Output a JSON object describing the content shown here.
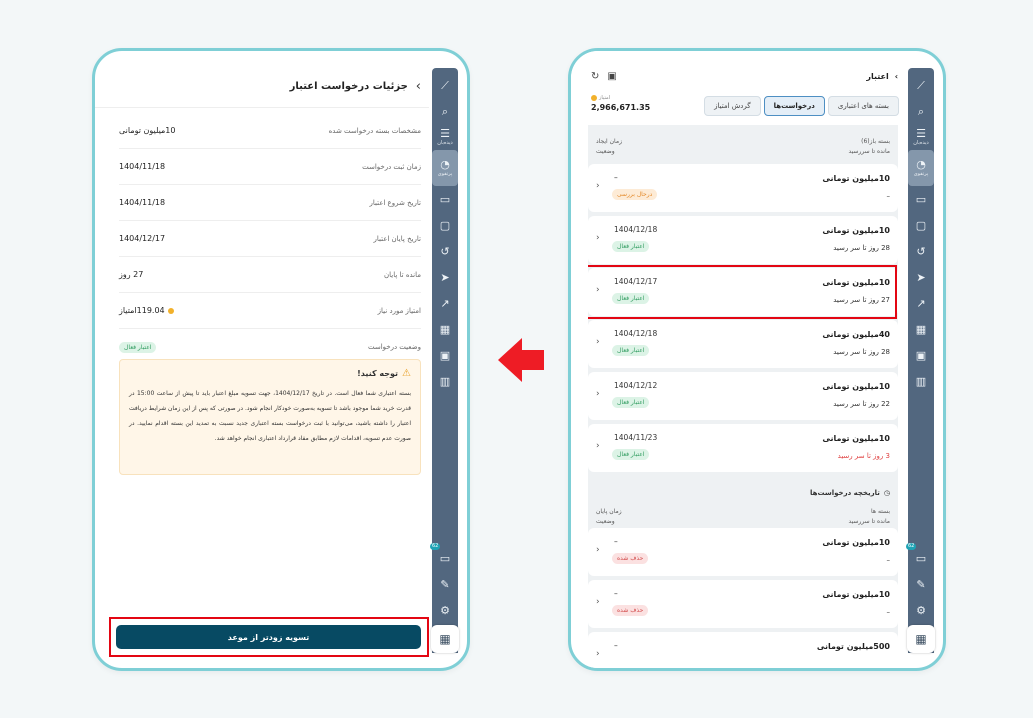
{
  "left": {
    "title": "جزئیات درخواست اعتبار",
    "rows": [
      {
        "label": "مشخصات بسته درخواست شده",
        "value": "10میلیون تومانی"
      },
      {
        "label": "زمان ثبت درخواست",
        "value": "1404/11/18"
      },
      {
        "label": "تاریخ شروع اعتبار",
        "value": "1404/11/18"
      },
      {
        "label": "تاریخ پایان اعتبار",
        "value": "1404/12/17"
      },
      {
        "label": "مانده تا پایان",
        "value": "27 روز"
      },
      {
        "label": "امتیاز مورد نیاز",
        "value": "119.04امتیاز"
      },
      {
        "label": "وضعیت درخواست",
        "value": "اعتبار فعال"
      }
    ],
    "notice_title": "توجه کنید!",
    "notice_body": "بسته اعتباری شما فعال است. در تاریخ 1404/12/17، جهت تسویه مبلغ اعتبار باید تا پیش از ساعت 15:00 در قدرت خرید شما موجود باشد تا تسویه به‌صورت خودکار انجام شود. در صورتی که پس از این زمان شرایط دریافت اعتبار را داشته باشید، می‌توانید با ثبت درخواست بسته اعتباری جدید نسبت به تمدید این بسته اقدام نمایید. در صورت عدم تسویه، اقدامات لازم مطابق مفاد قرارداد اعتباری انجام خواهد شد.",
    "cta": "تسویه زودتر از موعد"
  },
  "right": {
    "title": "اعتبار",
    "tabs": [
      "بسته های اعتباری",
      "درخواست‌ها",
      "گردش امتیاز"
    ],
    "balance_label": "امتیاز",
    "balance_value": "2,966,671.35",
    "open_header": {
      "right_top": "بسته باز(6)",
      "right_bottom": "مانده تا سررسید",
      "left_top": "زمان ایجاد",
      "left_bottom": "وضعیت"
    },
    "open_items": [
      {
        "name": "10میلیون تومانی",
        "remaining": "–",
        "date": "–",
        "status": "درحال بررسی",
        "status_type": "orange"
      },
      {
        "name": "10میلیون تومانی",
        "remaining": "28 روز تا سر رسید",
        "date": "1404/12/18",
        "status": "اعتبار فعال",
        "status_type": "green"
      },
      {
        "name": "10میلیون تومانی",
        "remaining": "27 روز تا سر رسید",
        "date": "1404/12/17",
        "status": "اعتبار فعال",
        "status_type": "green"
      },
      {
        "name": "40میلیون تومانی",
        "remaining": "28 روز تا سر رسید",
        "date": "1404/12/18",
        "status": "اعتبار فعال",
        "status_type": "green"
      },
      {
        "name": "10میلیون تومانی",
        "remaining": "22 روز تا سر رسید",
        "date": "1404/12/12",
        "status": "اعتبار فعال",
        "status_type": "green"
      },
      {
        "name": "10میلیون تومانی",
        "remaining": "3 روز تا سر رسید",
        "date": "1404/11/23",
        "status": "اعتبار فعال",
        "status_type": "green",
        "urgent": true
      }
    ],
    "history_title": "تاریخچه درخواست‌ها",
    "history_header": {
      "right_top": "بسته ها",
      "right_bottom": "مانده تا سررسید",
      "left_top": "زمان پایان",
      "left_bottom": "وضعیت"
    },
    "history_items": [
      {
        "name": "10میلیون تومانی",
        "remaining": "–",
        "date": "–",
        "status": "حذف شده",
        "status_type": "red"
      },
      {
        "name": "10میلیون تومانی",
        "remaining": "–",
        "date": "–",
        "status": "حذف شده",
        "status_type": "red"
      },
      {
        "name": "500میلیون تومانی",
        "remaining": "",
        "date": "–",
        "status": "",
        "status_type": "none"
      }
    ]
  },
  "sidebar": {
    "watch_label": "دیده‌بان",
    "portfolio_label": "پرتفوی",
    "chat_badge": "62"
  },
  "colors": {
    "accent": "#074a63",
    "frame": "#7fcfd6",
    "highlight": "#e30613",
    "sidebar": "#52677f"
  }
}
